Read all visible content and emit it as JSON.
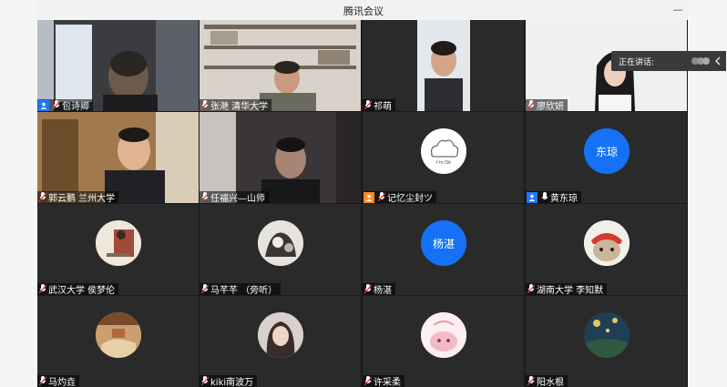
{
  "window": {
    "title": "腾讯会议"
  },
  "speaking": {
    "label": "正在讲话:"
  },
  "participants": [
    {
      "name": "包诗卿"
    },
    {
      "name": "张滟 清华大学"
    },
    {
      "name": "祁萌"
    },
    {
      "name": "廖欣妍"
    },
    {
      "name": "郭云鹏 兰州大学"
    },
    {
      "name": "任福兴—山师"
    },
    {
      "name": "记忆尘封ツ"
    },
    {
      "name": "黄东琼",
      "avatar_text": "东琼"
    },
    {
      "name": "武汉大学 侯梦伦"
    },
    {
      "name": "马芊芊 （旁听）"
    },
    {
      "name": "杨湛",
      "avatar_text": "杨湛"
    },
    {
      "name": "湖南大学 李知默"
    },
    {
      "name": "马灼垚"
    },
    {
      "name": "kiki南波万"
    },
    {
      "name": "许采柔"
    },
    {
      "name": "阳水根"
    }
  ],
  "colors": {
    "accent": "#1572f6",
    "host_badge": "#1e78ff",
    "cohost_badge": "#ff8a1e"
  }
}
